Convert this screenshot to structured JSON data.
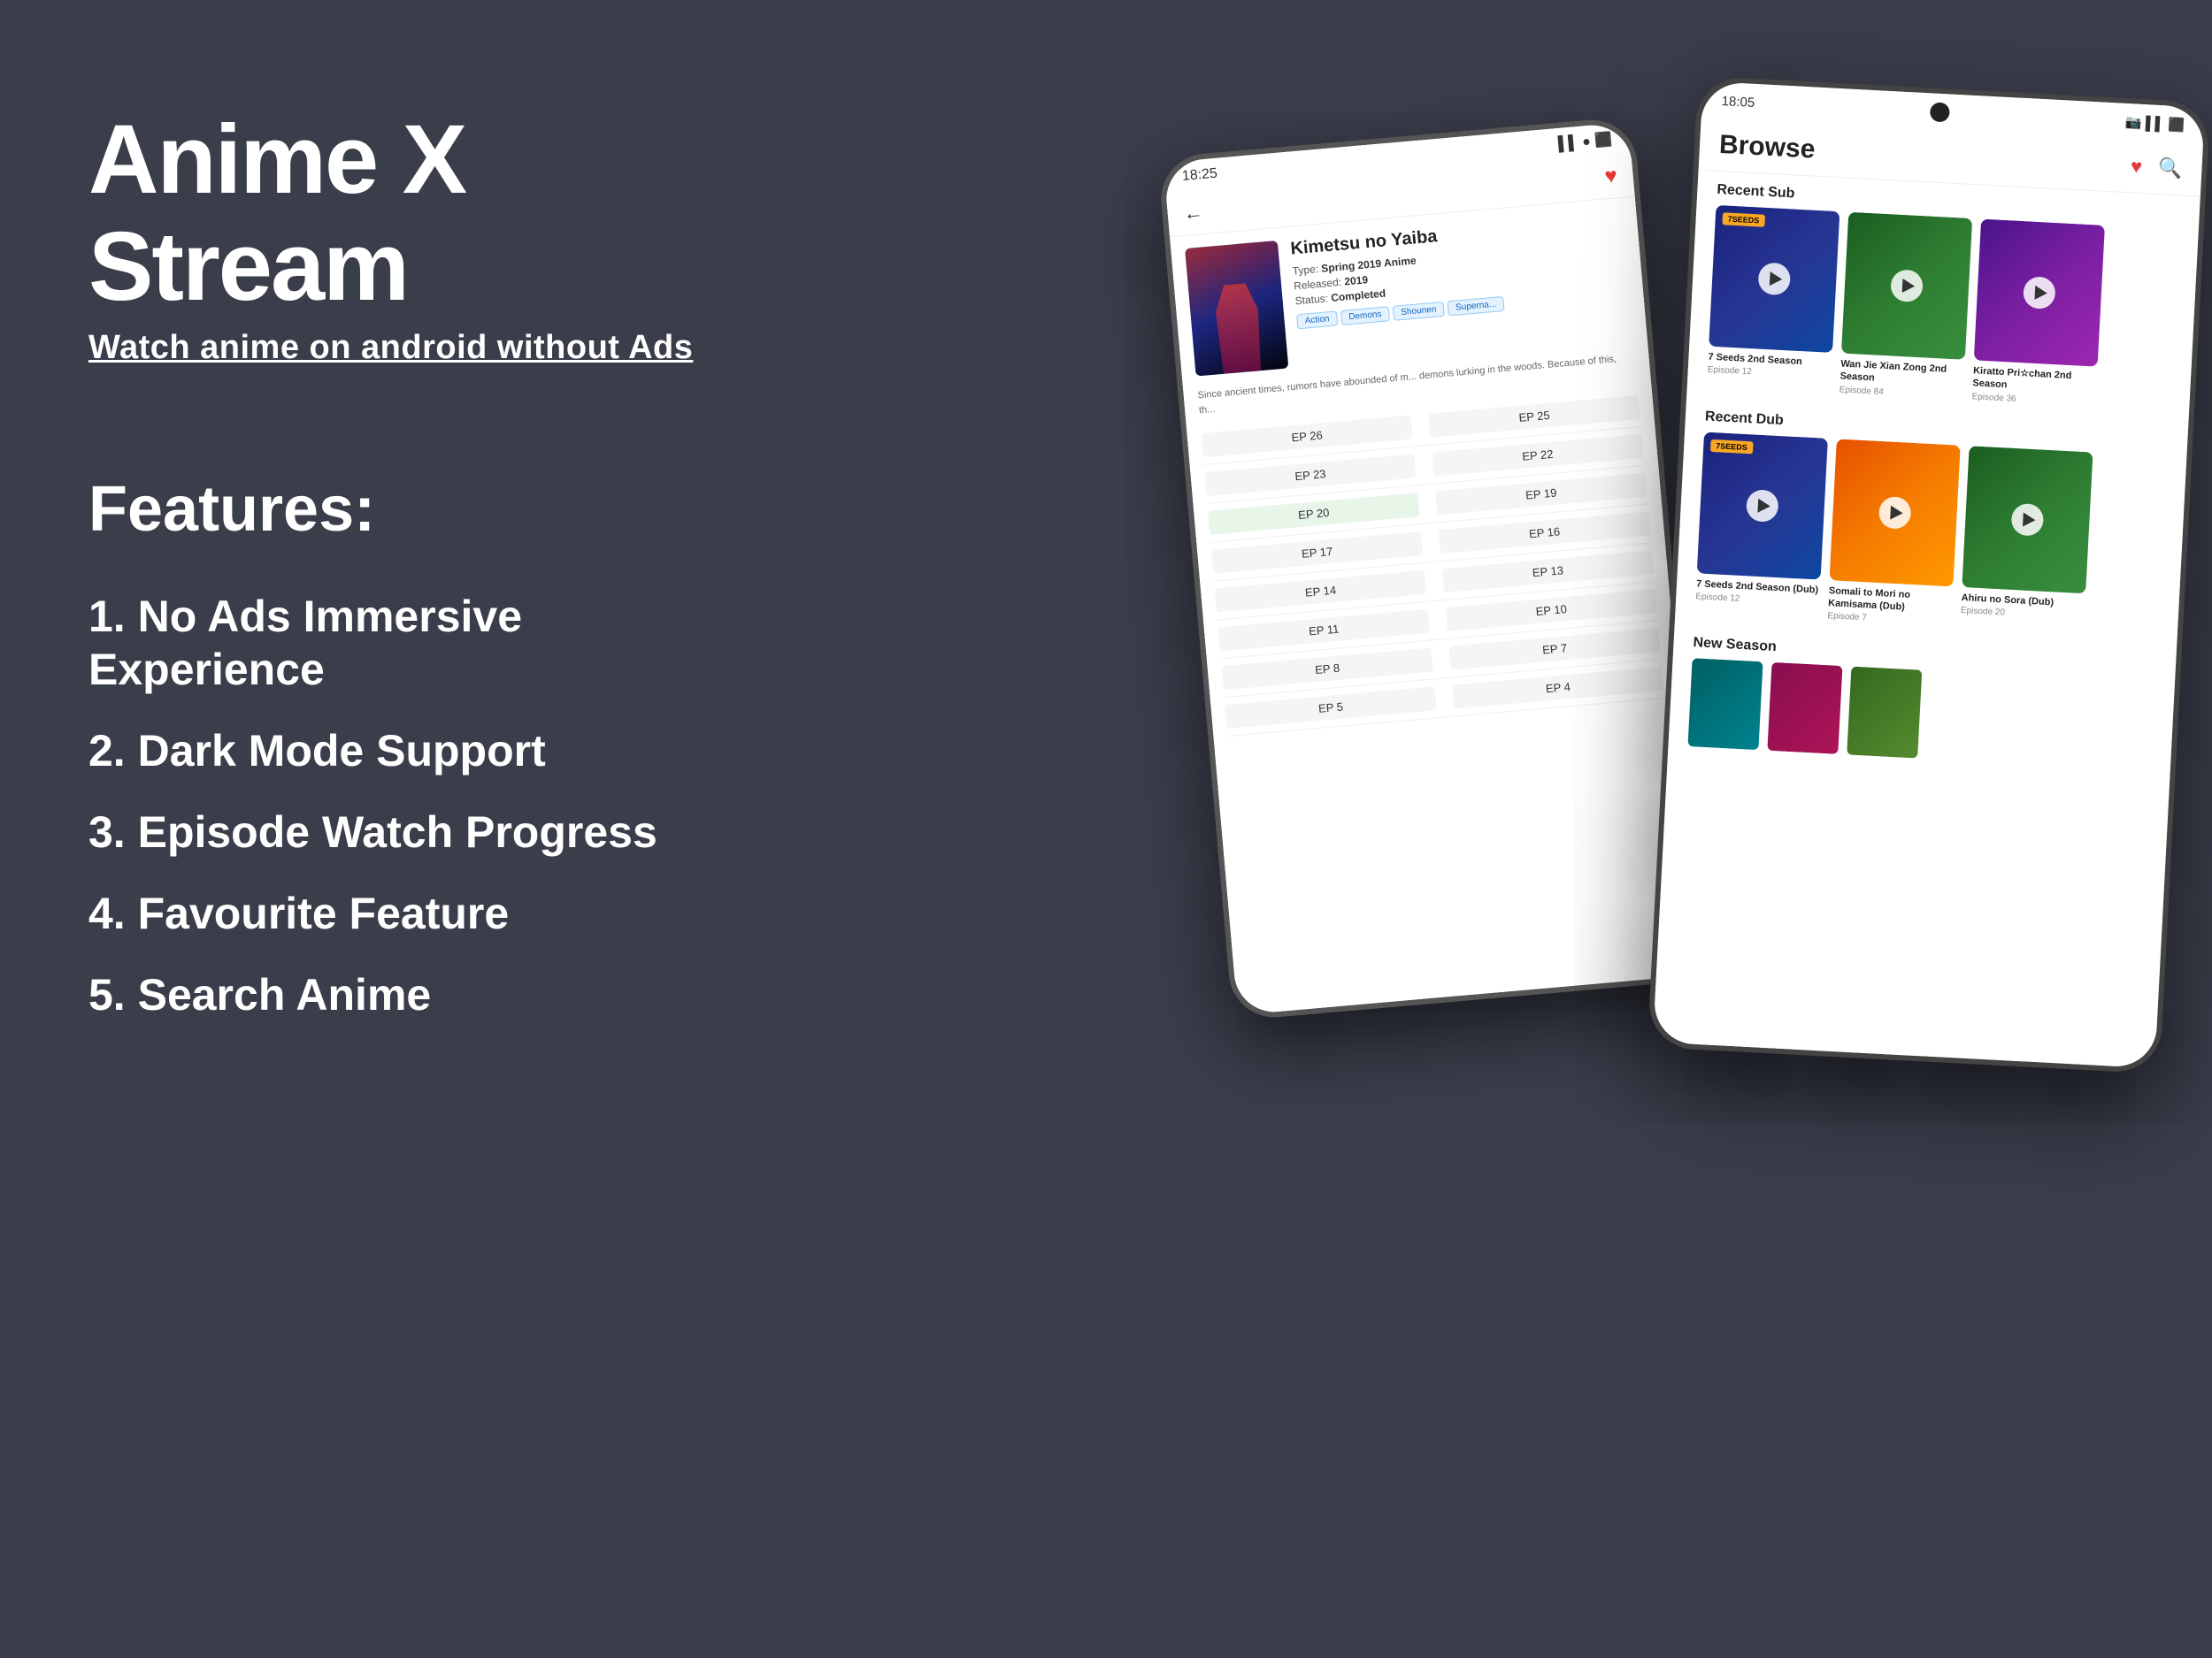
{
  "app": {
    "title": "Anime X Stream",
    "subtitle": "Watch anime on android without Ads"
  },
  "features": {
    "heading": "Features:",
    "items": [
      "1. No Ads Immersive Experience",
      "2. Dark Mode Support",
      "3. Episode Watch Progress",
      "4. Favourite Feature",
      "5. Search Anime"
    ]
  },
  "phone_back": {
    "status_time": "18:25",
    "anime_title": "Kimetsu no Yaiba",
    "anime_type": "Spring 2019 Anime",
    "anime_released": "2019",
    "anime_status": "Completed",
    "tags": [
      "Action",
      "Demons",
      "Shounen",
      "Superna..."
    ],
    "description": "Since ancient times, rumors have abounded of m... demons lurking in the woods. Because of this, th...",
    "episodes": [
      {
        "left": "EP 26",
        "right": "EP 25"
      },
      {
        "left": "EP 23",
        "right": "EP 22"
      },
      {
        "left": "EP 20",
        "right": "EP 19"
      },
      {
        "left": "EP 17",
        "right": "EP 16"
      },
      {
        "left": "EP 14",
        "right": "EP 13"
      },
      {
        "left": "EP 11",
        "right": "EP 10"
      },
      {
        "left": "EP 8",
        "right": "EP 7"
      },
      {
        "left": "EP 5",
        "right": "EP 4"
      }
    ]
  },
  "phone_front": {
    "status_time": "18:05",
    "browse_title": "Browse",
    "sections": {
      "recent_sub": {
        "label": "Recent Sub",
        "items": [
          {
            "name": "7 Seeds 2nd Season",
            "episode": "Episode 12"
          },
          {
            "name": "Wan Jie Xian Zong 2nd Season",
            "episode": "Episode 84"
          },
          {
            "name": "Kiratto Pri☆chan 2nd Season",
            "episode": "Episode 36"
          }
        ]
      },
      "recent_dub": {
        "label": "Recent Dub",
        "items": [
          {
            "name": "7 Seeds 2nd Season (Dub)",
            "episode": "Episode 12"
          },
          {
            "name": "Somali to Mori no Kamisama (Dub)",
            "episode": "Episode 7"
          },
          {
            "name": "Ahiru no Sora (Dub)",
            "episode": "Episode 20"
          }
        ]
      },
      "new_season": {
        "label": "New Season"
      }
    }
  },
  "colors": {
    "background": "#3a3d4a",
    "text_white": "#ffffff",
    "accent_red": "#e53935"
  }
}
